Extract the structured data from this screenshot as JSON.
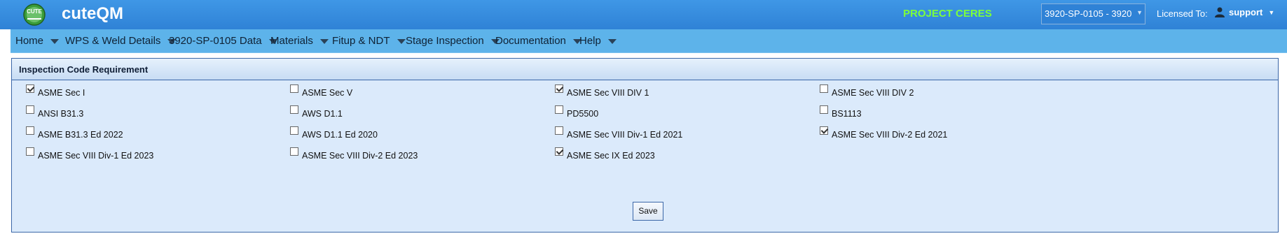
{
  "header": {
    "brand": "cuteQM",
    "logo_text": "CUTE",
    "project_name": "PROJECT CERES",
    "project_select_value": "3920-SP-0105 - 3920",
    "licensed_label": "Licensed To:",
    "user_name": "support",
    "colors": {
      "bar": "#2f82d6",
      "project": "#7cff3c",
      "nav": "#5db3ea"
    }
  },
  "nav": {
    "items": [
      {
        "label": "Home"
      },
      {
        "label": "WPS & Weld Details"
      },
      {
        "label": "3920-SP-0105 Data"
      },
      {
        "label": "Materials"
      },
      {
        "label": "Fitup & NDT"
      },
      {
        "label": "Stage Inspection"
      },
      {
        "label": "Documentation"
      },
      {
        "label": "Help"
      }
    ]
  },
  "panel": {
    "title": "Inspection Code Requirement",
    "checkboxes": [
      {
        "label": "ASME Sec I",
        "checked": true
      },
      {
        "label": "ASME Sec V",
        "checked": false
      },
      {
        "label": "ASME Sec VIII DIV 1",
        "checked": true
      },
      {
        "label": "ASME Sec VIII DIV 2",
        "checked": false
      },
      {
        "label": "ANSI B31.3",
        "checked": false
      },
      {
        "label": "AWS D1.1",
        "checked": false
      },
      {
        "label": "PD5500",
        "checked": false
      },
      {
        "label": "BS1113",
        "checked": false
      },
      {
        "label": "ASME B31.3 Ed 2022",
        "checked": false
      },
      {
        "label": "AWS D1.1 Ed 2020",
        "checked": false
      },
      {
        "label": "ASME Sec VIII Div-1 Ed 2021",
        "checked": false
      },
      {
        "label": "ASME Sec VIII Div-2 Ed 2021",
        "checked": true
      },
      {
        "label": "ASME Sec VIII Div-1 Ed 2023",
        "checked": false
      },
      {
        "label": "ASME Sec VIII Div-2 Ed 2023",
        "checked": false
      },
      {
        "label": "ASME Sec IX Ed 2023",
        "checked": true
      }
    ],
    "save_label": "Save"
  }
}
